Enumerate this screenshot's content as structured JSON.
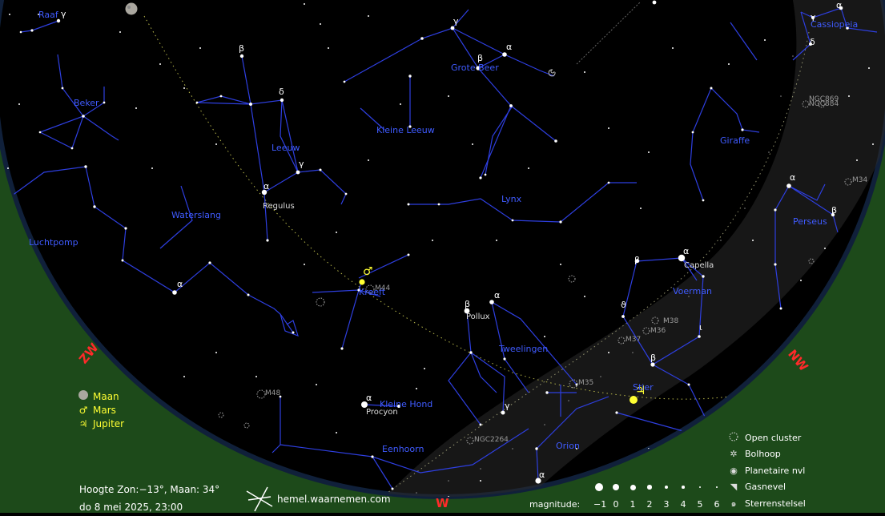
{
  "constellations": [
    {
      "name": "Raaf"
    },
    {
      "name": "Beker"
    },
    {
      "name": "Grote Beer"
    },
    {
      "name": "Kleine Leeuw"
    },
    {
      "name": "Leeuw"
    },
    {
      "name": "Waterslang"
    },
    {
      "name": "Luchtpomp"
    },
    {
      "name": "Kreeft"
    },
    {
      "name": "Lynx"
    },
    {
      "name": "Giraffe"
    },
    {
      "name": "Cassiopeia"
    },
    {
      "name": "Perseus"
    },
    {
      "name": "Voerman"
    },
    {
      "name": "Tweelingen"
    },
    {
      "name": "Stier"
    },
    {
      "name": "Kleine Hond"
    },
    {
      "name": "Eenhoorn"
    },
    {
      "name": "Orion"
    }
  ],
  "stars": [
    "Regulus",
    "Capella",
    "Pollux",
    "Procyon"
  ],
  "deep_sky": [
    "M44",
    "M48",
    "M35",
    "M37",
    "M36",
    "M38",
    "M34",
    "NGC2264",
    "NGC869",
    "NGC884"
  ],
  "compass": {
    "sw": "ZW",
    "w": "W",
    "nw": "NW"
  },
  "legend_planets": [
    {
      "icon": "moon",
      "label": "Maan"
    },
    {
      "icon": "mars",
      "symbol": "♂",
      "label": "Mars"
    },
    {
      "icon": "jupiter",
      "symbol": "♃",
      "label": "Jupiter"
    }
  ],
  "legend_objects": [
    {
      "icon": "open-cluster",
      "label": "Open cluster"
    },
    {
      "icon": "globular-cluster",
      "label": "Bolhoop"
    },
    {
      "icon": "planetary-nebula",
      "label": "Planetaire nvl"
    },
    {
      "icon": "gas-nebula",
      "label": "Gasnevel"
    },
    {
      "icon": "galaxy",
      "label": "Sterrenstelsel"
    }
  ],
  "magnitude": {
    "label": "magnitude:",
    "values": [
      "−1",
      "0",
      "1",
      "2",
      "3",
      "4",
      "5",
      "6"
    ]
  },
  "status": {
    "altitude": "Hoogte Zon:−13°, Maan: 34°",
    "datetime": "do  8 mei 2025,  23:00"
  },
  "brand": "hemel.waarnemen.com",
  "colors": {
    "horizon": "#1d4a1a",
    "lines": "#2e3fe0",
    "labels": "#3f5bff",
    "planet": "#ffff33",
    "compass": "#ff2a2a"
  }
}
